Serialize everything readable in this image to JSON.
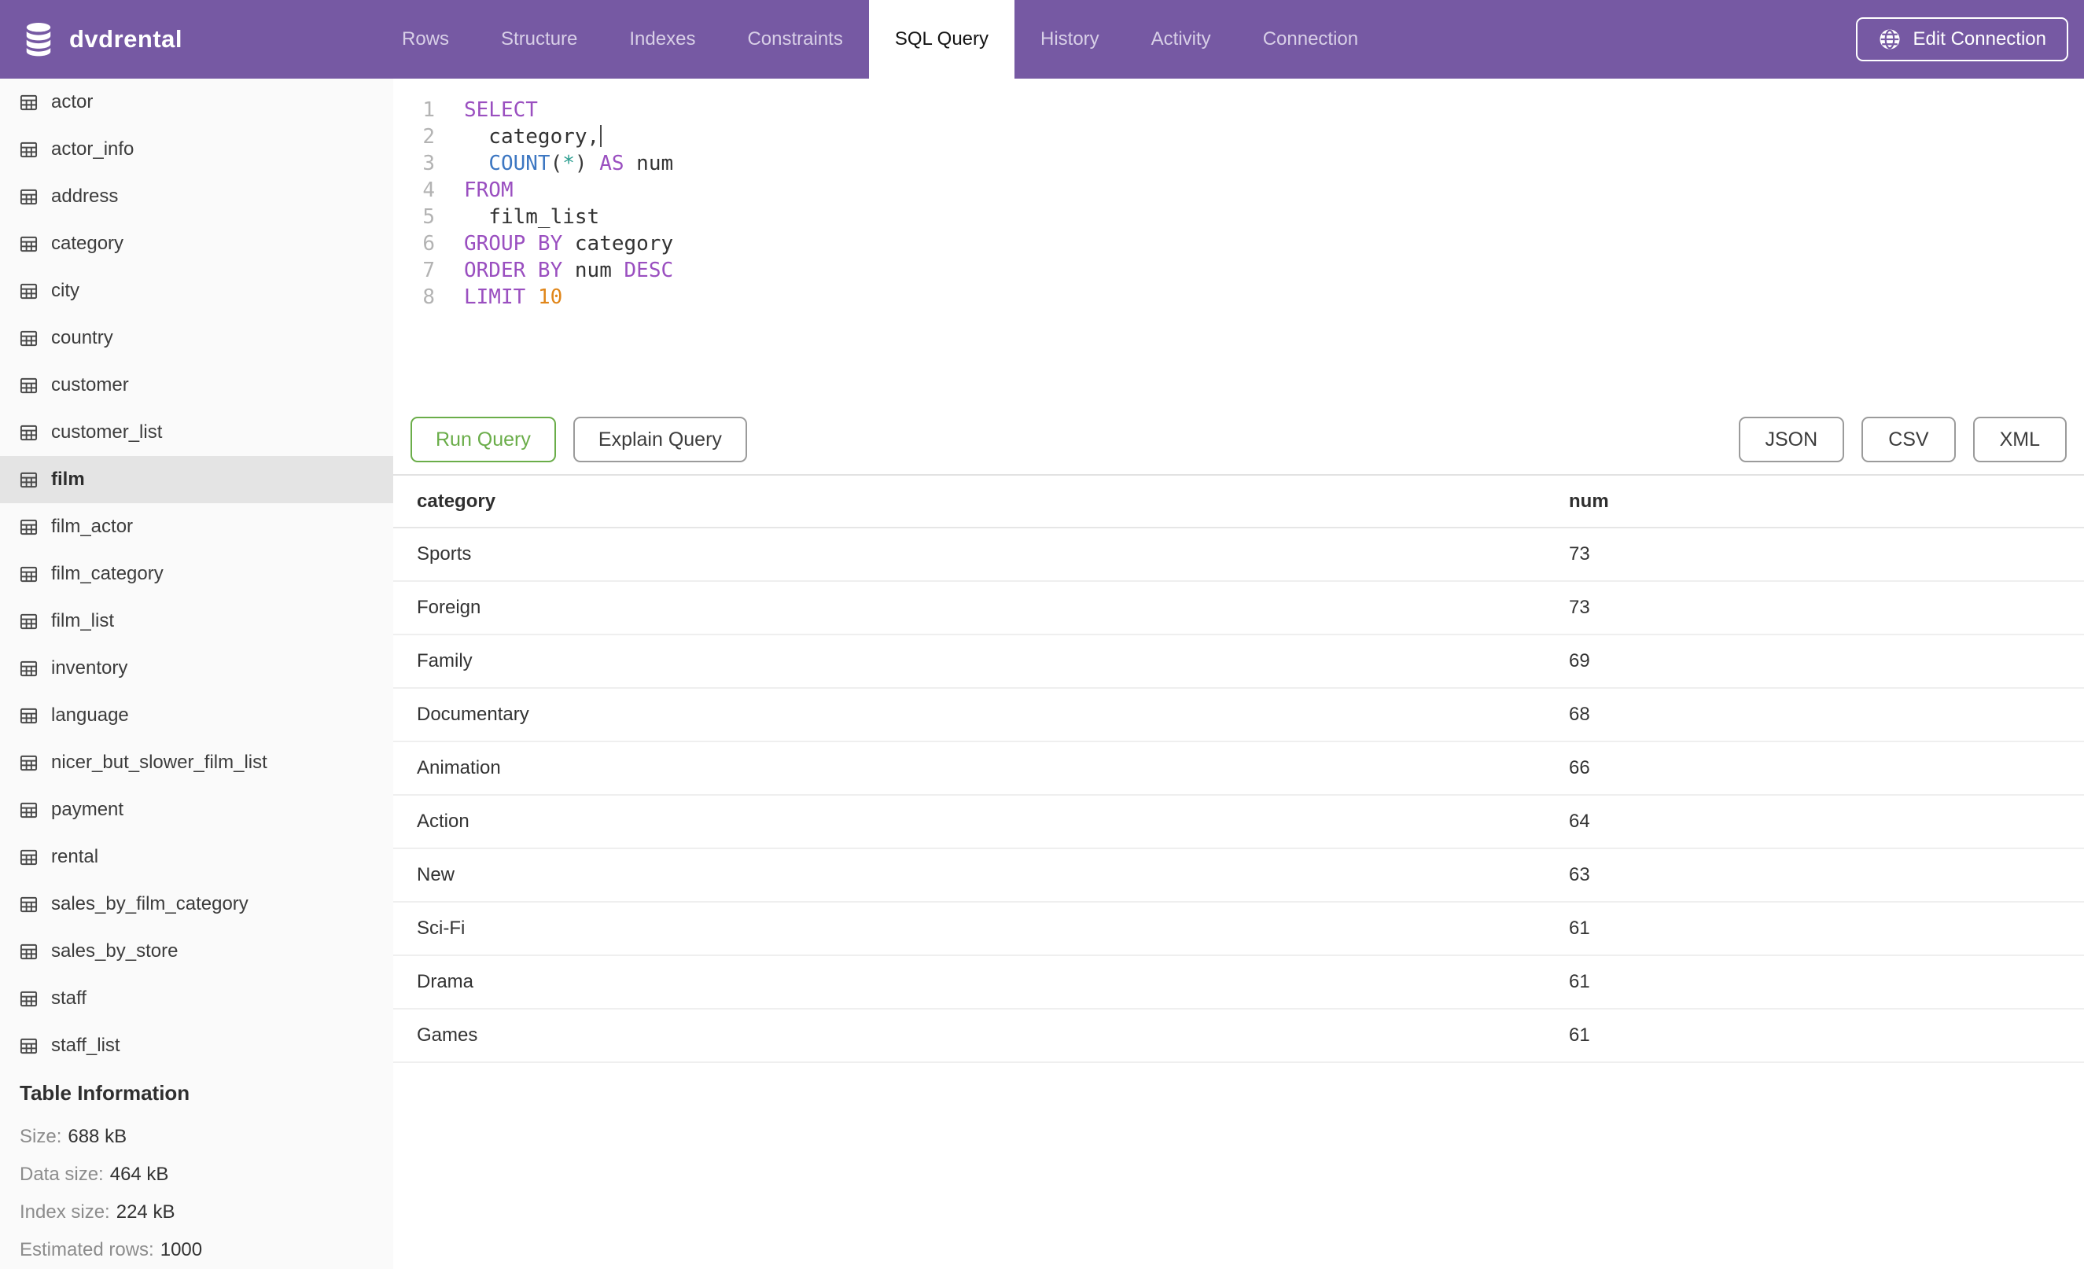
{
  "app": {
    "title": "dvdrental",
    "accent_color": "#7659a3",
    "run_green": "#6aad49",
    "selected_row_bg": "#e4e4e4",
    "icons": {
      "logo": "database-icon",
      "edit_connection": "globe-icon",
      "sidebar_item": "table-grid-icon"
    }
  },
  "navbar": {
    "tabs": [
      {
        "label": "Rows",
        "active": false
      },
      {
        "label": "Structure",
        "active": false
      },
      {
        "label": "Indexes",
        "active": false
      },
      {
        "label": "Constraints",
        "active": false
      },
      {
        "label": "SQL Query",
        "active": true
      },
      {
        "label": "History",
        "active": false
      },
      {
        "label": "Activity",
        "active": false
      },
      {
        "label": "Connection",
        "active": false
      }
    ],
    "edit_connection_label": "Edit Connection"
  },
  "sidebar": {
    "tables": [
      "actor",
      "actor_info",
      "address",
      "category",
      "city",
      "country",
      "customer",
      "customer_list",
      "film",
      "film_actor",
      "film_category",
      "film_list",
      "inventory",
      "language",
      "nicer_but_slower_film_list",
      "payment",
      "rental",
      "sales_by_film_category",
      "sales_by_store",
      "staff",
      "staff_list"
    ],
    "selected_table": "film",
    "table_information": {
      "heading": "Table Information",
      "rows": [
        {
          "label": "Size:",
          "value": "688 kB"
        },
        {
          "label": "Data size:",
          "value": "464 kB"
        },
        {
          "label": "Index size:",
          "value": "224 kB"
        },
        {
          "label": "Estimated rows:",
          "value": "1000"
        }
      ]
    }
  },
  "editor": {
    "query_text": "SELECT\n  category,\n  COUNT(*) AS num\nFROM\n  film_list\nGROUP BY category\nORDER BY num DESC\nLIMIT 10",
    "lines": [
      {
        "n": "1",
        "tokens": [
          [
            "kw",
            "SELECT"
          ]
        ]
      },
      {
        "n": "2",
        "tokens": [
          [
            "id",
            "  category"
          ],
          [
            "punc",
            ","
          ]
        ],
        "cursor": true
      },
      {
        "n": "3",
        "tokens": [
          [
            "id",
            "  "
          ],
          [
            "fn",
            "COUNT"
          ],
          [
            "punc",
            "("
          ],
          [
            "star",
            "*"
          ],
          [
            "punc",
            ")"
          ],
          [
            "id",
            " "
          ],
          [
            "kw",
            "AS"
          ],
          [
            "id",
            " num"
          ]
        ]
      },
      {
        "n": "4",
        "tokens": [
          [
            "kw",
            "FROM"
          ]
        ]
      },
      {
        "n": "5",
        "tokens": [
          [
            "id",
            "  film_list"
          ]
        ]
      },
      {
        "n": "6",
        "tokens": [
          [
            "kw",
            "GROUP BY"
          ],
          [
            "id",
            " category"
          ]
        ]
      },
      {
        "n": "7",
        "tokens": [
          [
            "kw",
            "ORDER BY"
          ],
          [
            "id",
            " num "
          ],
          [
            "kw",
            "DESC"
          ]
        ]
      },
      {
        "n": "8",
        "tokens": [
          [
            "kw",
            "LIMIT"
          ],
          [
            "id",
            " "
          ],
          [
            "num",
            "10"
          ]
        ]
      }
    ]
  },
  "actions": {
    "run_label": "Run Query",
    "explain_label": "Explain Query",
    "export_buttons": [
      "JSON",
      "CSV",
      "XML"
    ]
  },
  "results": {
    "columns": [
      "category",
      "num"
    ],
    "rows": [
      [
        "Sports",
        "73"
      ],
      [
        "Foreign",
        "73"
      ],
      [
        "Family",
        "69"
      ],
      [
        "Documentary",
        "68"
      ],
      [
        "Animation",
        "66"
      ],
      [
        "Action",
        "64"
      ],
      [
        "New",
        "63"
      ],
      [
        "Sci-Fi",
        "61"
      ],
      [
        "Drama",
        "61"
      ],
      [
        "Games",
        "61"
      ]
    ]
  }
}
